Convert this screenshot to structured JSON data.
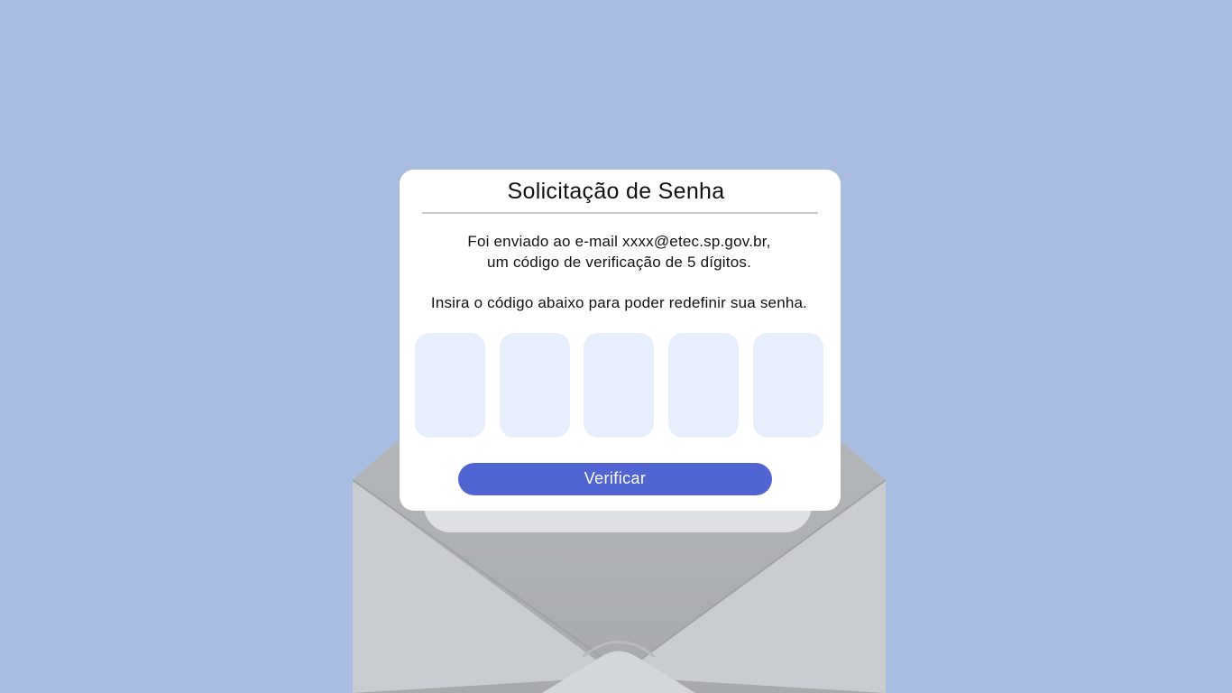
{
  "header": {
    "title": "Solicitação de Senha"
  },
  "message": {
    "line1": "Foi enviado ao e-mail xxxx@etec.sp.gov.br,",
    "line2": "um código de verificação de 5 dígitos.",
    "line3": "Insira o código abaixo para poder redefinir sua senha."
  },
  "code_inputs": [
    {
      "value": ""
    },
    {
      "value": ""
    },
    {
      "value": ""
    },
    {
      "value": ""
    },
    {
      "value": ""
    }
  ],
  "actions": {
    "verify_label": "Verificar"
  },
  "colors": {
    "background": "#a9bde0",
    "card": "#ffffff",
    "code_box": "#e8effc",
    "button": "#5064d2",
    "envelope_body": "#c9ccd0",
    "envelope_inner": "#adb0b3"
  },
  "icons": [
    "envelope-illustration"
  ]
}
